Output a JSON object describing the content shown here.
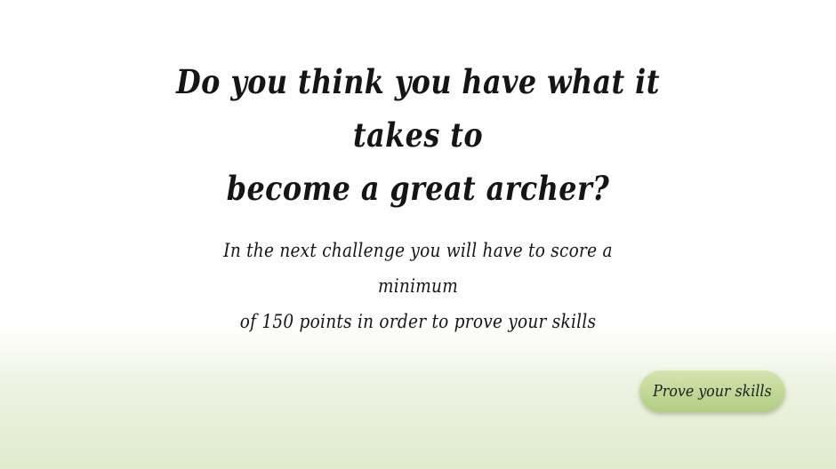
{
  "intro": {
    "headline_line1": "Do you think you have what it takes to",
    "headline_line2": "become a great archer?",
    "body_line1": "In the next challenge you will have to score a minimum",
    "body_line2": "of 150 points in order to prove your skills"
  },
  "actions": {
    "prove_label": "Prove your skills"
  },
  "colors": {
    "button_green": "#c1d795",
    "background_bottom": "#e0ebcc",
    "text": "#151515"
  }
}
